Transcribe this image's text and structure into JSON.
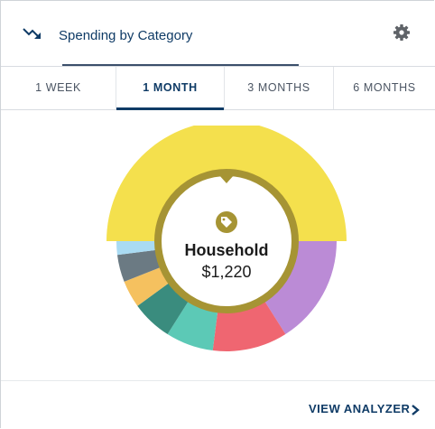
{
  "header": {
    "title": "Spending by Category",
    "icon": "trending-down-icon",
    "settings_icon": "gear-icon"
  },
  "tabs": [
    {
      "label": "1 WEEK",
      "active": false
    },
    {
      "label": "1 MONTH",
      "active": true
    },
    {
      "label": "3 MONTHS",
      "active": false
    },
    {
      "label": "6 MONTHS",
      "active": false
    }
  ],
  "donut": {
    "selected": {
      "category": "Household",
      "amount": "$1,220",
      "icon": "tag-icon"
    },
    "segments": [
      {
        "color": "#f4e04d",
        "share": 0.5,
        "selected": true
      },
      {
        "color": "#bb8bd6",
        "share": 0.16
      },
      {
        "color": "#ef6671",
        "share": 0.11
      },
      {
        "color": "#5cc9b6",
        "share": 0.07
      },
      {
        "color": "#3a8c7e",
        "share": 0.06
      },
      {
        "color": "#f5c15f",
        "share": 0.04
      },
      {
        "color": "#6b7a83",
        "share": 0.04
      },
      {
        "color": "#a9dbf3",
        "share": 0.02
      }
    ],
    "ring_color": "#a69434"
  },
  "footer": {
    "link_label": "VIEW ANALYZER",
    "link_icon": "chevron-right-icon"
  }
}
